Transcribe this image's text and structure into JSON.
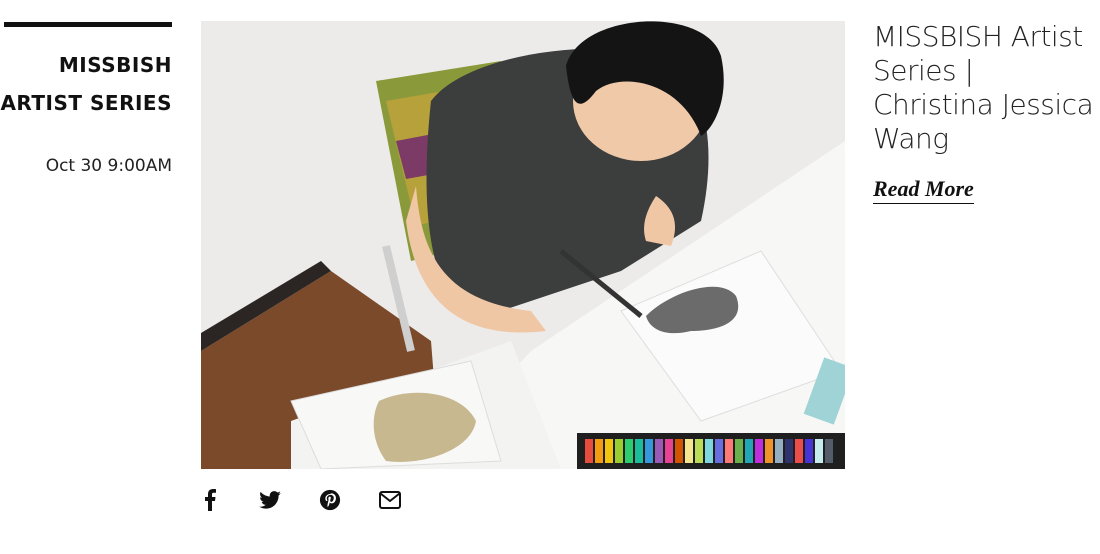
{
  "article": {
    "category_line1": "MISSBISH",
    "category_line2": "ARTIST SERIES",
    "date": "Oct 30 9:00AM",
    "title": "MISSBISH Artist Series | Christina Jessica Wang",
    "read_more": "Read More",
    "image_alt": "Artist drawing a sweater illustration at a white desk"
  },
  "share": {
    "icons": [
      "facebook-icon",
      "twitter-icon",
      "pinterest-icon",
      "email-icon"
    ]
  }
}
